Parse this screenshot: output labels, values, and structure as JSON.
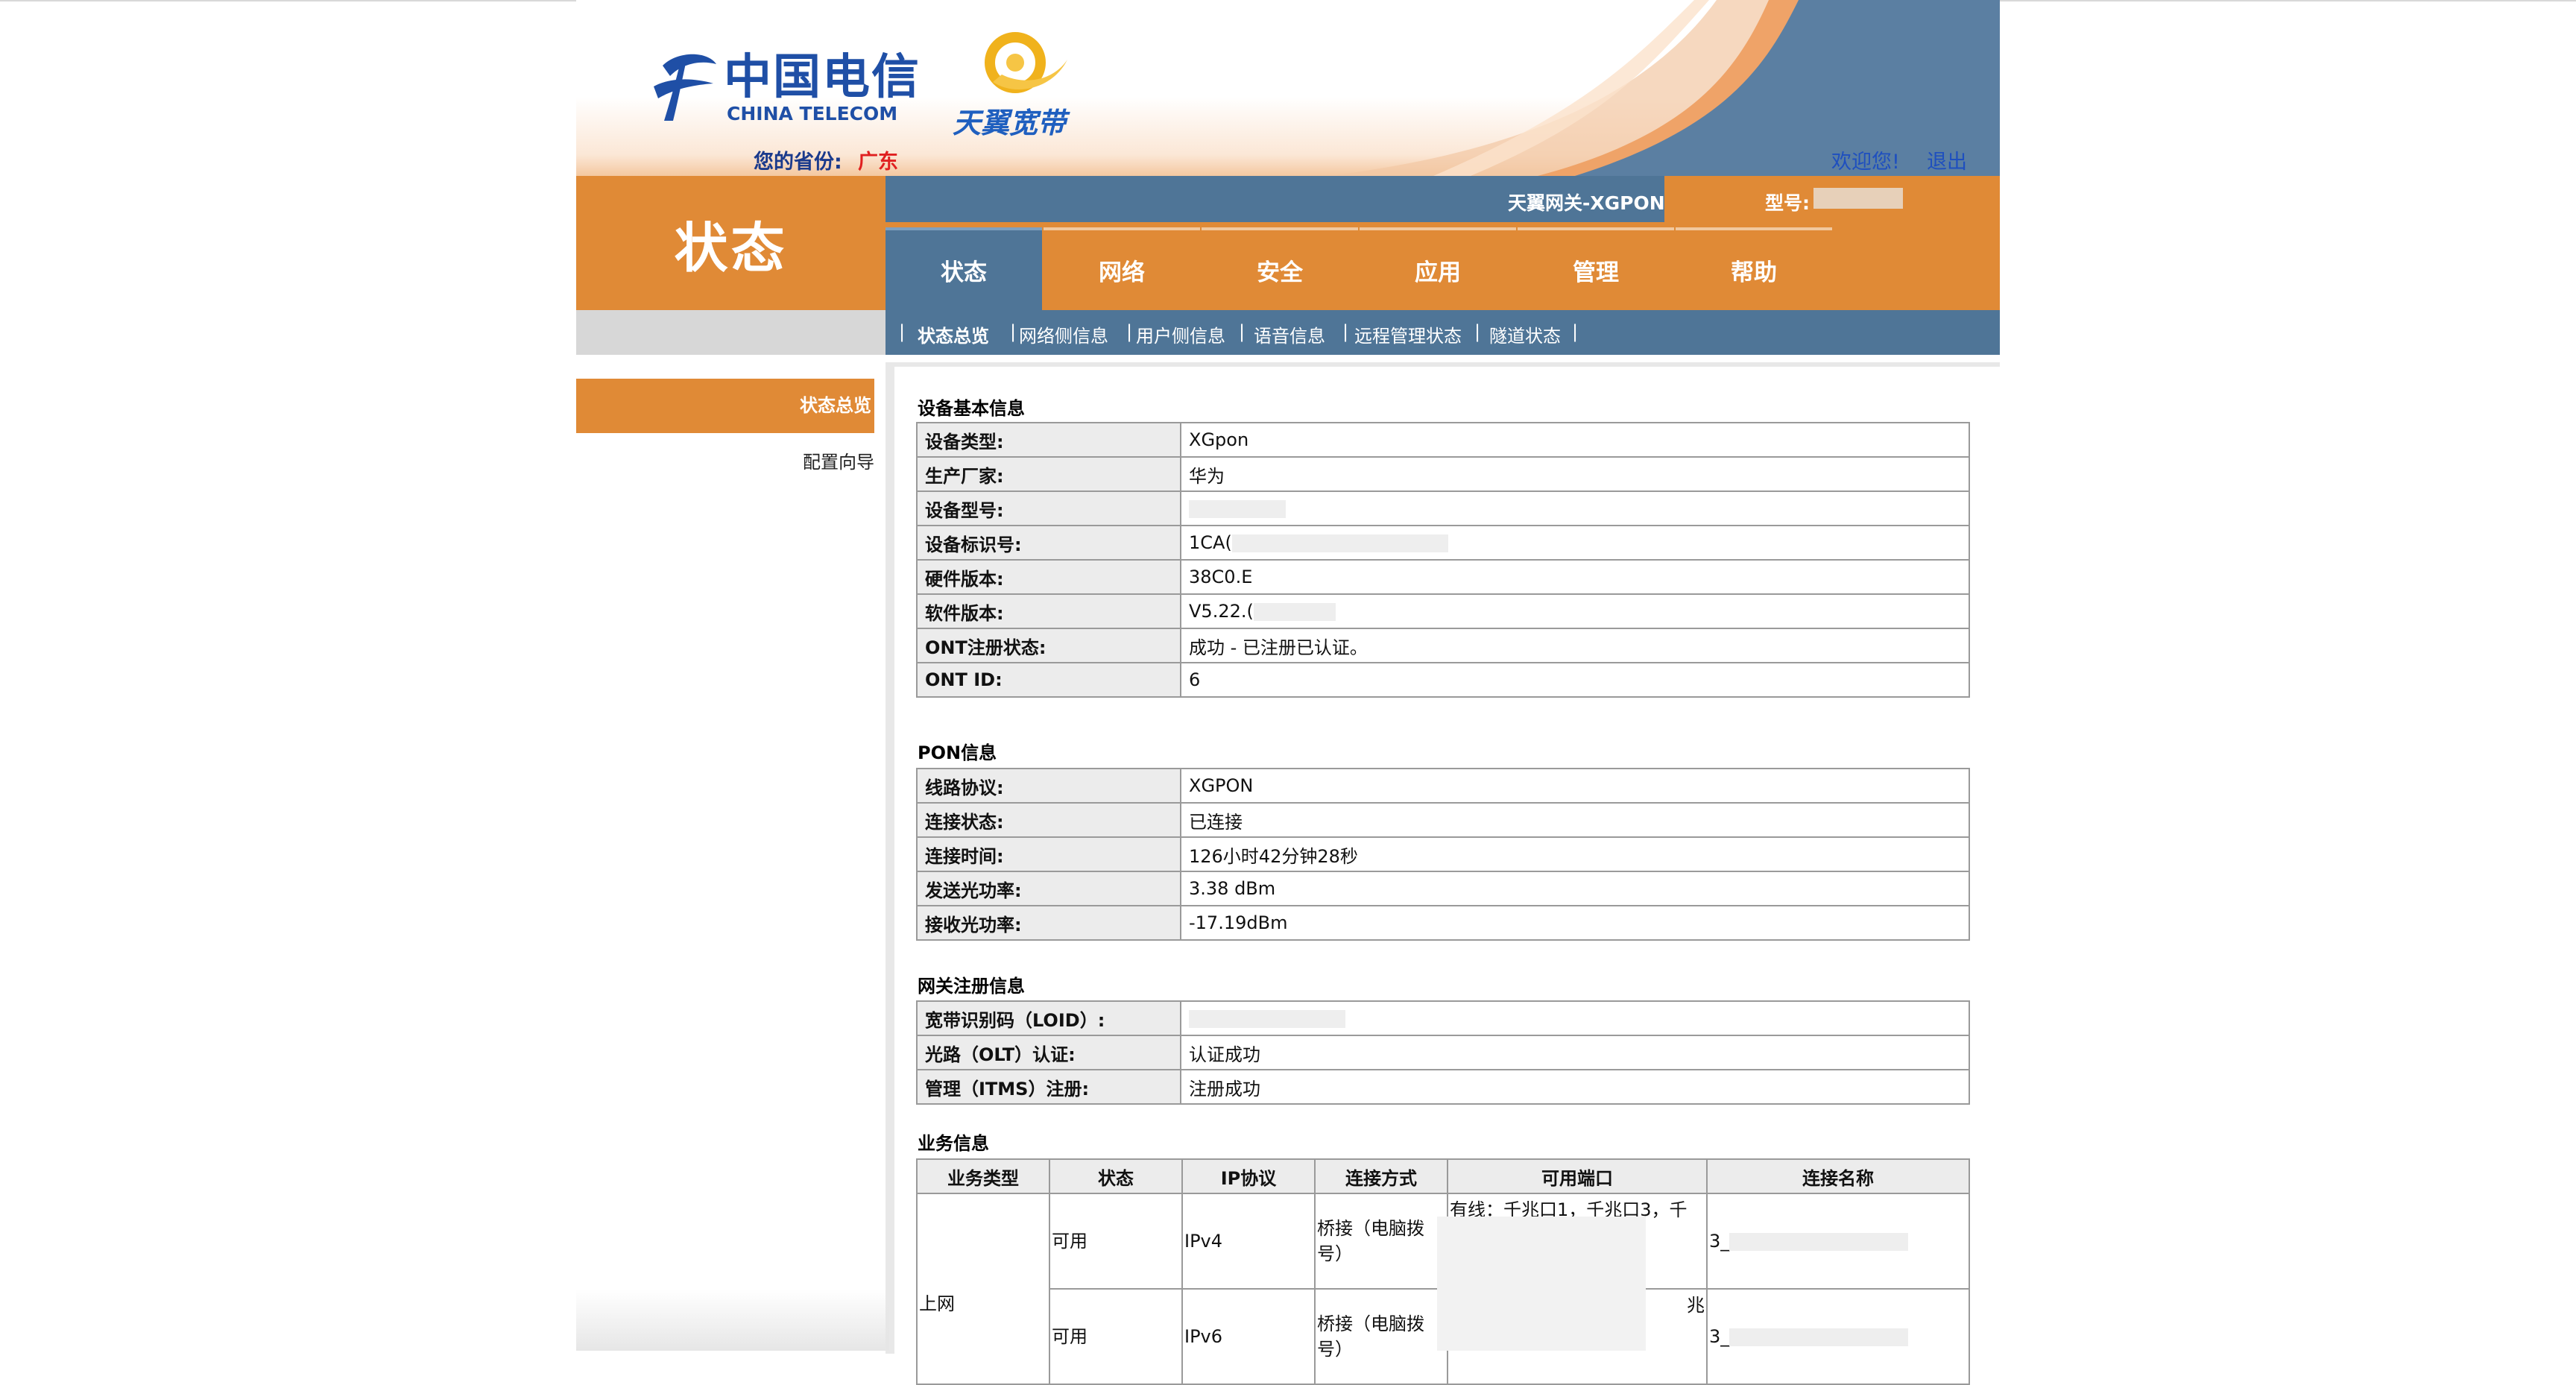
{
  "header": {
    "brand_cn": "中国电信",
    "brand_en": "CHINA TELECOM",
    "sub_brand": "天翼宽带",
    "province_label": "您的省份:",
    "province_value": "广东",
    "welcome": "欢迎您!",
    "logout": "退出"
  },
  "page_title": "状态",
  "gateway_name": "天翼网关-XGPON",
  "model_label": "型号:",
  "tabs": [
    "状态",
    "网络",
    "安全",
    "应用",
    "管理",
    "帮助"
  ],
  "subnav": [
    "状态总览",
    "网络侧信息",
    "用户侧信息",
    "语音信息",
    "远程管理状态",
    "隧道状态"
  ],
  "sidebar": [
    "状态总览",
    "配置向导"
  ],
  "sections": {
    "device": {
      "title": "设备基本信息",
      "rows": [
        {
          "k": "设备类型:",
          "v": "XGpon"
        },
        {
          "k": "生产厂家:",
          "v": "华为"
        },
        {
          "k": "设备型号:",
          "v": ""
        },
        {
          "k": "设备标识号:",
          "v": "1CA("
        },
        {
          "k": "硬件版本:",
          "v": "38C0.E"
        },
        {
          "k": "软件版本:",
          "v": "V5.22.("
        },
        {
          "k": "ONT注册状态:",
          "v": "成功 - 已注册已认证。"
        },
        {
          "k": "ONT ID:",
          "v": "6"
        }
      ]
    },
    "pon": {
      "title": "PON信息",
      "rows": [
        {
          "k": "线路协议:",
          "v": "XGPON"
        },
        {
          "k": "连接状态:",
          "v": "已连接"
        },
        {
          "k": "连接时间:",
          "v": "126小时42分钟28秒"
        },
        {
          "k": "发送光功率:",
          "v": "3.38 dBm"
        },
        {
          "k": "接收光功率:",
          "v": "-17.19dBm"
        }
      ]
    },
    "gateway": {
      "title": "网关注册信息",
      "rows": [
        {
          "k": "宽带识别码（LOID）:",
          "v": ""
        },
        {
          "k": "光路（OLT）认证:",
          "v": "认证成功"
        },
        {
          "k": "管理（ITMS）注册:",
          "v": "注册成功"
        }
      ]
    },
    "services": {
      "title": "业务信息",
      "headers": [
        "业务类型",
        "状态",
        "IP协议",
        "连接方式",
        "可用端口",
        "连接名称"
      ],
      "service_type": "上网",
      "rows": [
        {
          "status": "可用",
          "ip": "IPv4",
          "mode": "桥接（电脑拨号）",
          "ports": "有线：千兆口1，千兆口3，千兆",
          "name": "3_"
        },
        {
          "status": "可用",
          "ip": "IPv6",
          "mode": "桥接（电脑拨号）",
          "ports": "兆",
          "name": "3_"
        }
      ]
    }
  }
}
